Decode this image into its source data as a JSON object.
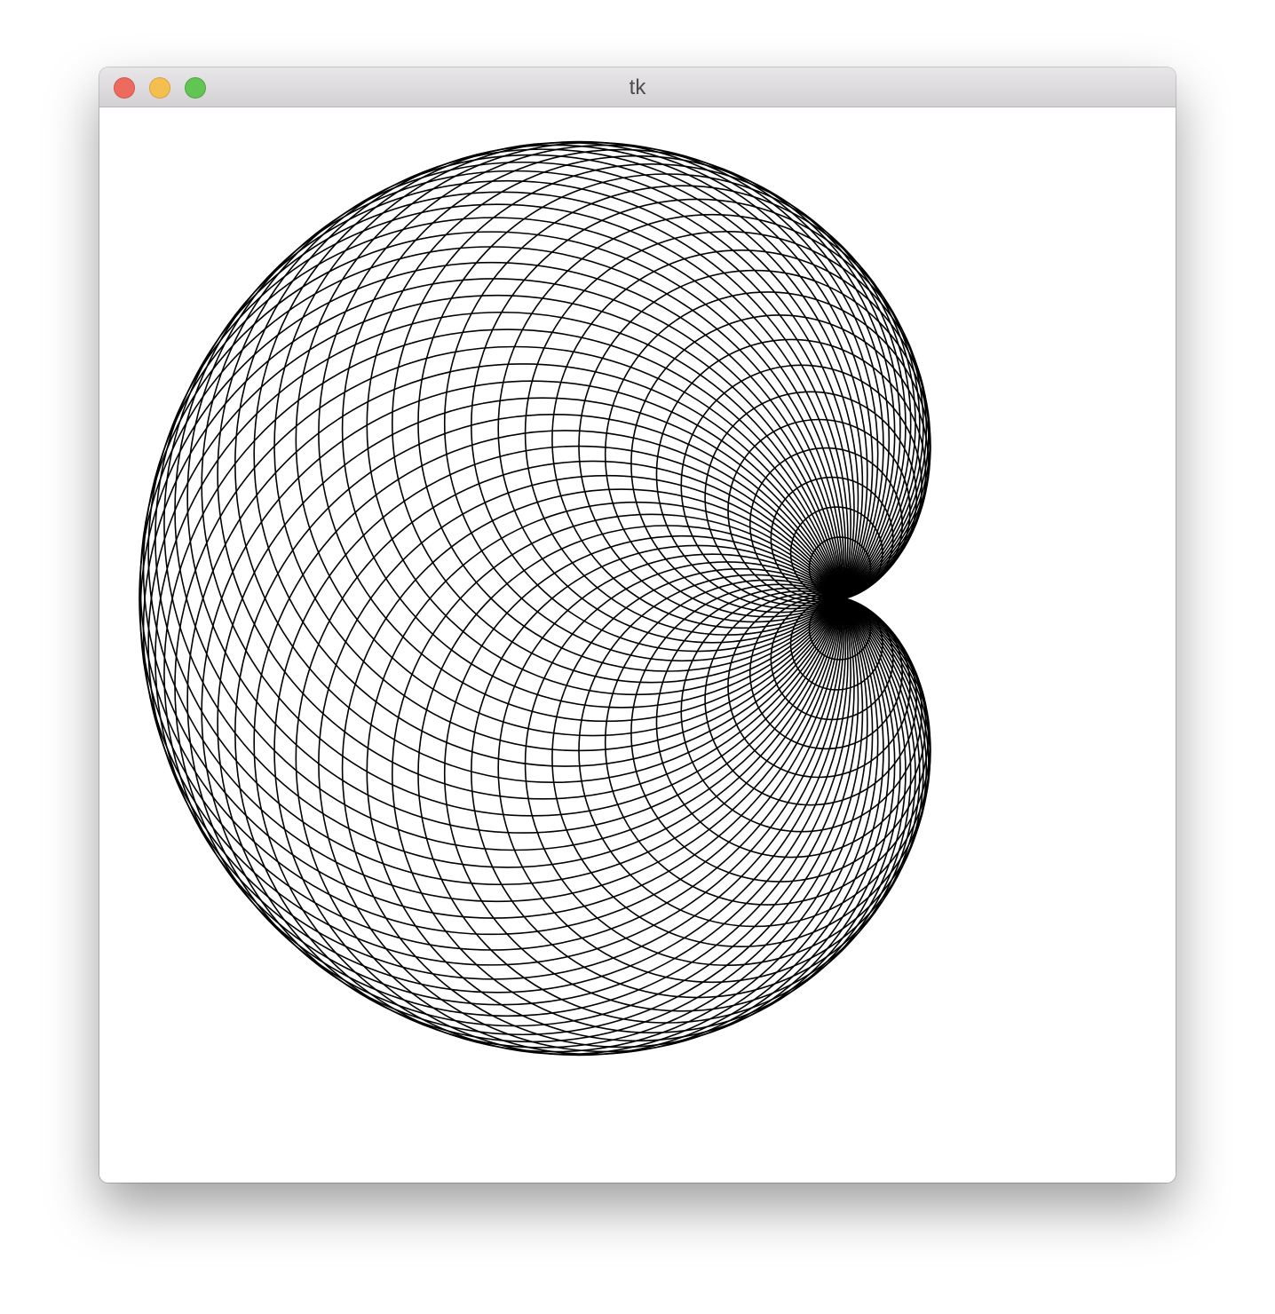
{
  "window": {
    "title": "tk",
    "buttons": {
      "close": "close-button",
      "minimize": "minimize-button",
      "zoom": "zoom-button"
    },
    "colors": {
      "close": "#ed6a5e",
      "minimize": "#f5bf4f",
      "zoom": "#61c554"
    }
  },
  "drawing": {
    "shape": "cardioid formed by circles",
    "stroke_color": "#000000",
    "background_color": "#ffffff",
    "circle_count": 72
  }
}
